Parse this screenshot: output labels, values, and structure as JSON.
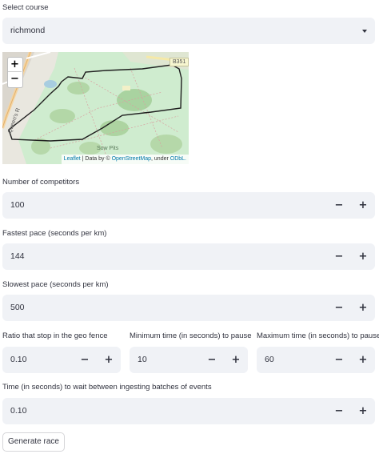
{
  "course": {
    "label": "Select course",
    "value": "richmond"
  },
  "map": {
    "zoom_in": "+",
    "zoom_out": "−",
    "road_label": "B351",
    "street_label": "Queen's R",
    "place_label": "Sow Pits",
    "attribution": {
      "leaflet": "Leaflet",
      "data_by": " | Data by © ",
      "osm": "OpenStreetMap",
      "under": ", under ",
      "license": "ODbL."
    }
  },
  "competitors": {
    "label": "Number of competitors",
    "value": "100"
  },
  "fastest": {
    "label": "Fastest pace (seconds per km)",
    "value": "144"
  },
  "slowest": {
    "label": "Slowest pace (seconds per km)",
    "value": "500"
  },
  "ratio": {
    "label": "Ratio that stop in the geo fence",
    "value": "0.10"
  },
  "min_pause": {
    "label": "Minimum time (in seconds) to pause",
    "value": "10"
  },
  "max_pause": {
    "label": "Maximum time (in seconds) to pause",
    "value": "60"
  },
  "wait": {
    "label": "Time (in seconds) to wait between ingesting batches of events",
    "value": "0.10"
  },
  "stepper": {
    "minus": "−",
    "plus": "+"
  },
  "generate_button": "Generate race"
}
